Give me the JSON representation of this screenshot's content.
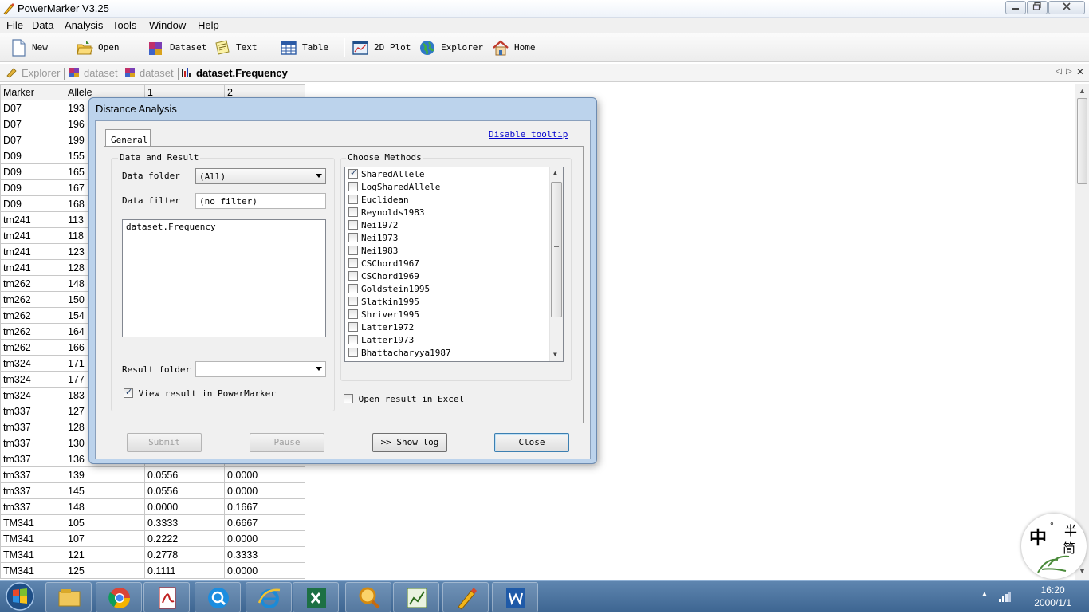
{
  "window": {
    "title": "PowerMarker V3.25",
    "minimize_icon": "minimize-icon",
    "maximize_icon": "restore-icon",
    "close_icon": "close-icon"
  },
  "menu": [
    "File",
    "Data",
    "Analysis",
    "Tools",
    "Window",
    "Help"
  ],
  "toolbar": {
    "new": "New",
    "open": "Open",
    "dataset": "Dataset",
    "text": "Text",
    "table": "Table",
    "plot": "2D Plot",
    "explorer": "Explorer",
    "home": "Home"
  },
  "tabs": {
    "explorer": "Explorer",
    "dataset1": "dataset",
    "dataset2": "dataset",
    "frequency": "dataset.Frequency",
    "nav_left": "◁",
    "nav_right": "▷",
    "close": "✕"
  },
  "grid": {
    "headers": [
      "Marker",
      "Allele",
      "1",
      "2"
    ],
    "rows": [
      [
        "D07",
        "193",
        "",
        ""
      ],
      [
        "D07",
        "196",
        "",
        ""
      ],
      [
        "D07",
        "199",
        "",
        ""
      ],
      [
        "D09",
        "155",
        "",
        ""
      ],
      [
        "D09",
        "165",
        "",
        ""
      ],
      [
        "D09",
        "167",
        "",
        ""
      ],
      [
        "D09",
        "168",
        "",
        ""
      ],
      [
        "tm241",
        "113",
        "",
        ""
      ],
      [
        "tm241",
        "118",
        "",
        ""
      ],
      [
        "tm241",
        "123",
        "",
        ""
      ],
      [
        "tm241",
        "128",
        "",
        ""
      ],
      [
        "tm262",
        "148",
        "",
        ""
      ],
      [
        "tm262",
        "150",
        "",
        ""
      ],
      [
        "tm262",
        "154",
        "",
        ""
      ],
      [
        "tm262",
        "164",
        "",
        ""
      ],
      [
        "tm262",
        "166",
        "",
        ""
      ],
      [
        "tm324",
        "171",
        "",
        ""
      ],
      [
        "tm324",
        "177",
        "",
        ""
      ],
      [
        "tm324",
        "183",
        "",
        ""
      ],
      [
        "tm337",
        "127",
        "",
        ""
      ],
      [
        "tm337",
        "128",
        "",
        ""
      ],
      [
        "tm337",
        "130",
        "",
        ""
      ],
      [
        "tm337",
        "136",
        "",
        ""
      ],
      [
        "tm337",
        "139",
        "0.0556",
        "0.0000"
      ],
      [
        "tm337",
        "145",
        "0.0556",
        "0.0000"
      ],
      [
        "tm337",
        "148",
        "0.0000",
        "0.1667"
      ],
      [
        "TM341",
        "105",
        "0.3333",
        "0.6667"
      ],
      [
        "TM341",
        "107",
        "0.2222",
        "0.0000"
      ],
      [
        "TM341",
        "121",
        "0.2778",
        "0.3333"
      ],
      [
        "TM341",
        "125",
        "0.1111",
        "0.0000"
      ]
    ]
  },
  "dialog": {
    "title": "Distance Analysis",
    "tab_general": "General",
    "disable_tooltip": "Disable tooltip",
    "data_result_label": "Data and Result",
    "data_folder_label": "Data folder",
    "data_folder_value": "(All)",
    "data_filter_label": "Data filter",
    "data_filter_value": "(no filter)",
    "dataset_list": [
      "dataset.Frequency"
    ],
    "result_folder_label": "Result folder",
    "result_folder_value": "",
    "view_result_label": "View result in PowerMarker",
    "view_result_checked": true,
    "choose_methods_label": "Choose Methods",
    "methods": [
      {
        "name": "SharedAllele",
        "checked": true
      },
      {
        "name": "LogSharedAllele",
        "checked": false
      },
      {
        "name": "Euclidean",
        "checked": false
      },
      {
        "name": "Reynolds1983",
        "checked": false
      },
      {
        "name": "Nei1972",
        "checked": false
      },
      {
        "name": "Nei1973",
        "checked": false
      },
      {
        "name": "Nei1983",
        "checked": false
      },
      {
        "name": "CSChord1967",
        "checked": false
      },
      {
        "name": "CSChord1969",
        "checked": false
      },
      {
        "name": "Goldstein1995",
        "checked": false
      },
      {
        "name": "Slatkin1995",
        "checked": false
      },
      {
        "name": "Shriver1995",
        "checked": false
      },
      {
        "name": "Latter1972",
        "checked": false
      },
      {
        "name": "Latter1973",
        "checked": false
      },
      {
        "name": "Bhattacharyya1987",
        "checked": false
      }
    ],
    "open_excel_label": "Open result in Excel",
    "open_excel_checked": false,
    "buttons": {
      "submit": "Submit",
      "pause": "Pause",
      "show_log": ">> Show log",
      "close": "Close"
    }
  },
  "taskbar": {
    "apps": [
      "windows-explorer-icon",
      "chrome-icon",
      "pdf-reader-icon",
      "dictionary-icon",
      "internet-explorer-icon",
      "excel-icon",
      "search-tool-icon",
      "chart-app-icon",
      "powermarker-icon",
      "word-icon"
    ],
    "time": "16:20",
    "date": "2000/1/1"
  },
  "ime": {
    "chars": [
      "中",
      "°",
      "半",
      "简"
    ]
  },
  "colors": {
    "dialog_frame": "#bcd3ec",
    "taskbar": "#4f76a2",
    "link": "#0000cc"
  }
}
